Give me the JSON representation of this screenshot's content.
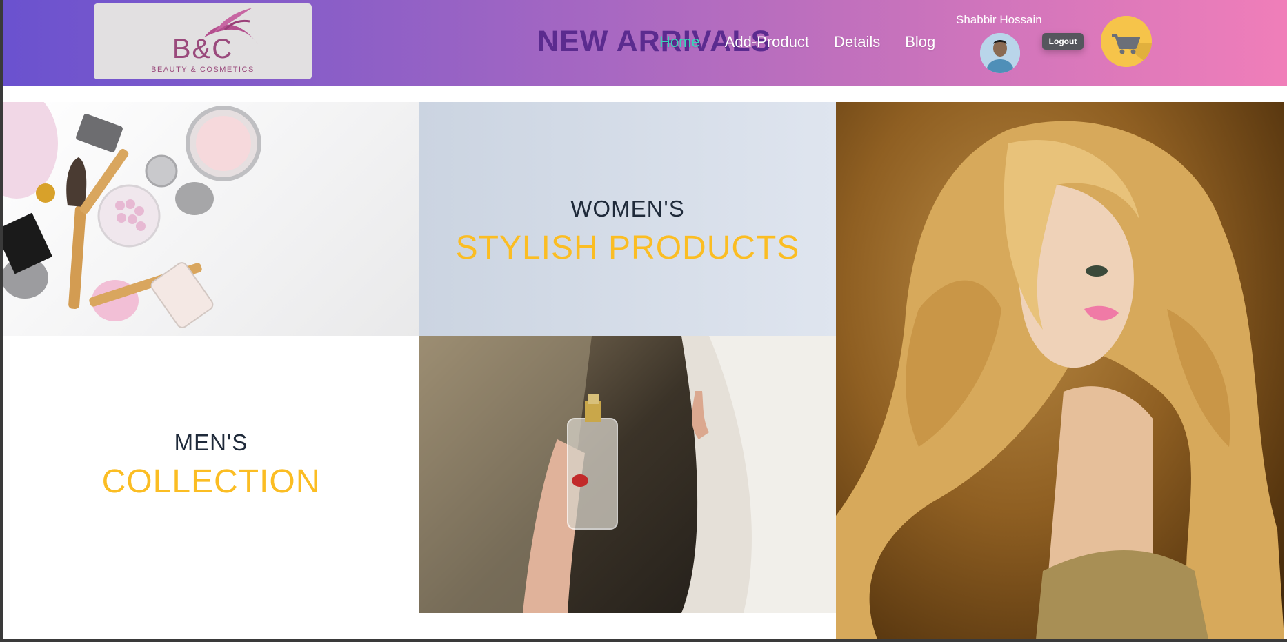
{
  "header": {
    "logo": {
      "text": "B&C",
      "tagline": "BEAUTY & COSMETICS"
    },
    "banner_title": "NEW ARRIVALS",
    "nav": [
      {
        "label": "Home",
        "active": true
      },
      {
        "label": "Add-Product",
        "active": false
      },
      {
        "label": "Details",
        "active": false
      },
      {
        "label": "Blog",
        "active": false
      }
    ],
    "user": {
      "name": "Shabbir Hossain",
      "avatar_icon": "user-avatar"
    },
    "logout_label": "Logout",
    "cart_icon": "shopping-cart-icon"
  },
  "promos": {
    "women": {
      "subtitle": "WOMEN'S",
      "title": "STYLISH PRODUCTS"
    },
    "men": {
      "subtitle": "MEN'S",
      "title": "COLLECTION"
    }
  },
  "colors": {
    "header_gradient_start": "#6a52cf",
    "header_gradient_end": "#f07eb9",
    "accent_yellow": "#fbbd23",
    "nav_active": "#39d4b8",
    "heading_dark": "#1f2a3a"
  }
}
